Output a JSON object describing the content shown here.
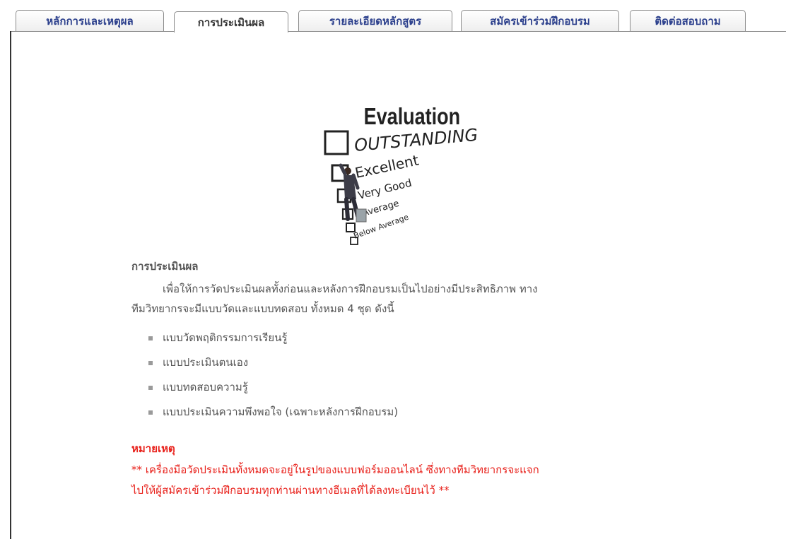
{
  "tabs": [
    {
      "label": "หลักการและเหตุผล"
    },
    {
      "label": "การประเมินผล"
    },
    {
      "label": "รายละเอียดหลักสูตร"
    },
    {
      "label": "สมัครเข้าร่วมฝึกอบรม"
    },
    {
      "label": "ติดต่อสอบถาม"
    }
  ],
  "active_tab": "การประเมินผล",
  "hero": {
    "title": "Evaluation",
    "options": [
      "OUTSTANDING",
      "Excellent",
      "Very Good",
      "Average",
      "Below Average"
    ]
  },
  "section": {
    "title": "การประเมินผล",
    "paragraph_line1": "เพื่อให้การวัดประเมินผลทั้งก่อนและหลังการฝึกอบรมเป็นไปอย่างมีประสิทธิภาพ ทาง",
    "paragraph_line2": "ทีมวิทยากรจะมีแบบวัดและแบบทดสอบ ทั้งหมด 4 ชุด ดังนี้",
    "items": [
      "แบบวัดพฤติกรรมการเรียนรู้",
      "แบบประเมินตนเอง",
      "แบบทดสอบความรู้",
      "แบบประเมินความพึงพอใจ (เฉพาะหลังการฝึกอบรม)"
    ]
  },
  "note": {
    "title": "หมายเหตุ",
    "line1": "** เครื่องมือวัดประเมินทั้งหมดจะอยู่ในรูปของแบบฟอร์มออนไลน์ ซึ่งทางทีมวิทยากรจะแจก",
    "line2": "ไปให้ผู้สมัครเข้าร่วมฝึกอบรมทุกท่านผ่านทางอีเมลที่ได้ลงทะเบียนไว้ **"
  },
  "colors": {
    "tab_text": "#2b3f8c",
    "note": "#e8201a",
    "body_text": "#555555"
  }
}
